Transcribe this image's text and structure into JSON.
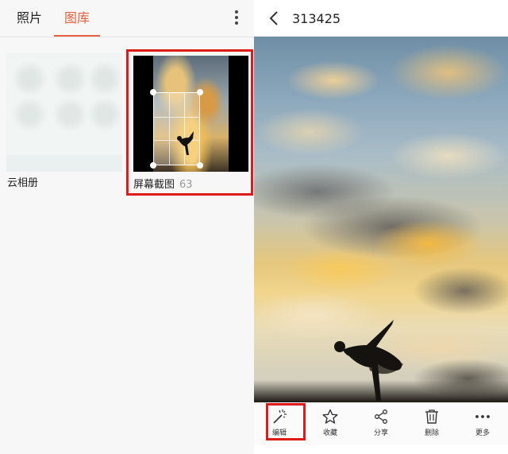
{
  "tabs": {
    "photos_label": "照片",
    "library_label": "图库",
    "active": "图库"
  },
  "albums": [
    {
      "name": "云相册",
      "count": ""
    },
    {
      "name": "屏幕截图",
      "count": "63"
    }
  ],
  "viewer": {
    "title": "313425"
  },
  "actions": {
    "edit": "编辑",
    "favorite": "收藏",
    "share": "分享",
    "delete": "删除",
    "more": "更多"
  },
  "colors": {
    "accent": "#e8603c",
    "highlight": "#e0191b"
  },
  "icons": [
    "more-vertical-icon",
    "back-arrow-icon",
    "magic-wand-icon",
    "star-icon",
    "share-icon",
    "trash-icon",
    "more-horizontal-icon"
  ]
}
